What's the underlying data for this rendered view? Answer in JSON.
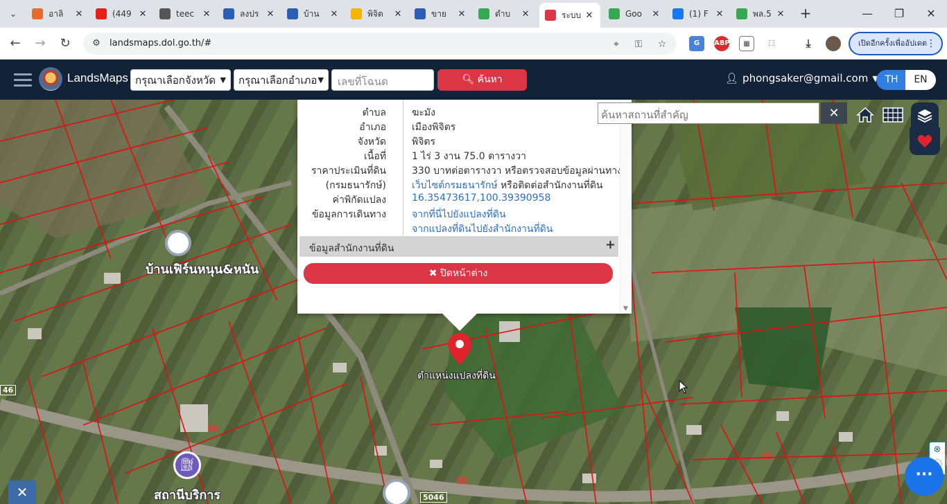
{
  "browser": {
    "tabs": [
      {
        "title": "อาลิ",
        "favicon": "aliexpress-icon",
        "color": "#e7692c"
      },
      {
        "title": "(449",
        "favicon": "youtube-icon",
        "color": "#e62117"
      },
      {
        "title": "teec",
        "favicon": "globe-icon",
        "color": "#555555"
      },
      {
        "title": "ลงปร",
        "favicon": "house-icon",
        "color": "#2a5fb5"
      },
      {
        "title": "บ้าน",
        "favicon": "house-icon",
        "color": "#2a5fb5"
      },
      {
        "title": "พิจิต",
        "favicon": "pinwheel-icon",
        "color": "#f4b400"
      },
      {
        "title": "ขาย",
        "favicon": "house-icon",
        "color": "#2a5fb5"
      },
      {
        "title": "ตำบ",
        "favicon": "maps-pin-icon",
        "color": "#34a853"
      },
      {
        "title": "ระบบ",
        "favicon": "location-pin-icon",
        "color": "#dc3545",
        "active": true
      },
      {
        "title": "Goo",
        "favicon": "maps-pin-icon",
        "color": "#34a853"
      },
      {
        "title": "(1) F",
        "favicon": "facebook-icon",
        "color": "#1877f2"
      },
      {
        "title": "พล.5",
        "favicon": "maps-pin-icon",
        "color": "#34a853"
      }
    ],
    "url": "landsmaps.dol.go.th/#",
    "update_label": "เปิดอีกครั้งเพื่ออัปเดต"
  },
  "header": {
    "brand": "LandsMaps",
    "province_select": "กรุณาเลือกจังหวัด",
    "district_select": "กรุณาเลือกอำเภอ",
    "parcel_placeholder": "เลขที่โฉนด",
    "search_label": "ค้นหา",
    "user_email": "phongsaker@gmail.com",
    "lang_th": "TH",
    "lang_en": "EN"
  },
  "popup": {
    "rows": [
      {
        "key": "ตำบล",
        "value": "ฆะมัง",
        "link": false
      },
      {
        "key": "อำเภอ",
        "value": "เมืองพิจิตร",
        "link": false
      },
      {
        "key": "จังหวัด",
        "value": "พิจิตร",
        "link": false
      },
      {
        "key": "เนื้อที่",
        "value": "1 ไร่ 3 งาน 75.0 ตารางวา",
        "link": false
      },
      {
        "key": "ราคาประเมินที่ดิน",
        "value": "330 บาทต่อตารางวา หรือตรวจสอบข้อมูลผ่านทาง",
        "link": false
      },
      {
        "key": "(กรมธนารักษ์)",
        "value_link": "เว็บไซต์กรมธนารักษ์",
        "value_rest": " หรือติดต่อสำนักงานที่ดิน"
      },
      {
        "key": "ค่าพิกัดแปลง",
        "value": "16.35473617,100.39390958",
        "link": true
      },
      {
        "key": "ข้อมูลการเดินทาง",
        "value": "จากที่นี่ไปยังแปลงที่ดิน",
        "link": true
      },
      {
        "key": "",
        "value": "จากแปลงที่ดินไปยังสำนักงานที่ดิน",
        "link": true
      }
    ],
    "office_section": "ข้อมูลสำนักงานที่ดิน",
    "close_label": "ปิดหน้าต่าง"
  },
  "map": {
    "place_search_placeholder": "ค้นหาสถานที่สำคัญ",
    "marker_label": "ตำแหน่งแปลงที่ดิน",
    "labels": [
      {
        "text": "บ้านเฟิร์นหนุน&หนัน"
      },
      {
        "text": "สถานีบริการ"
      }
    ],
    "road_shields": [
      "46",
      "5046"
    ],
    "accent": "#dc3545",
    "parcel_line_color": "#e01010"
  }
}
